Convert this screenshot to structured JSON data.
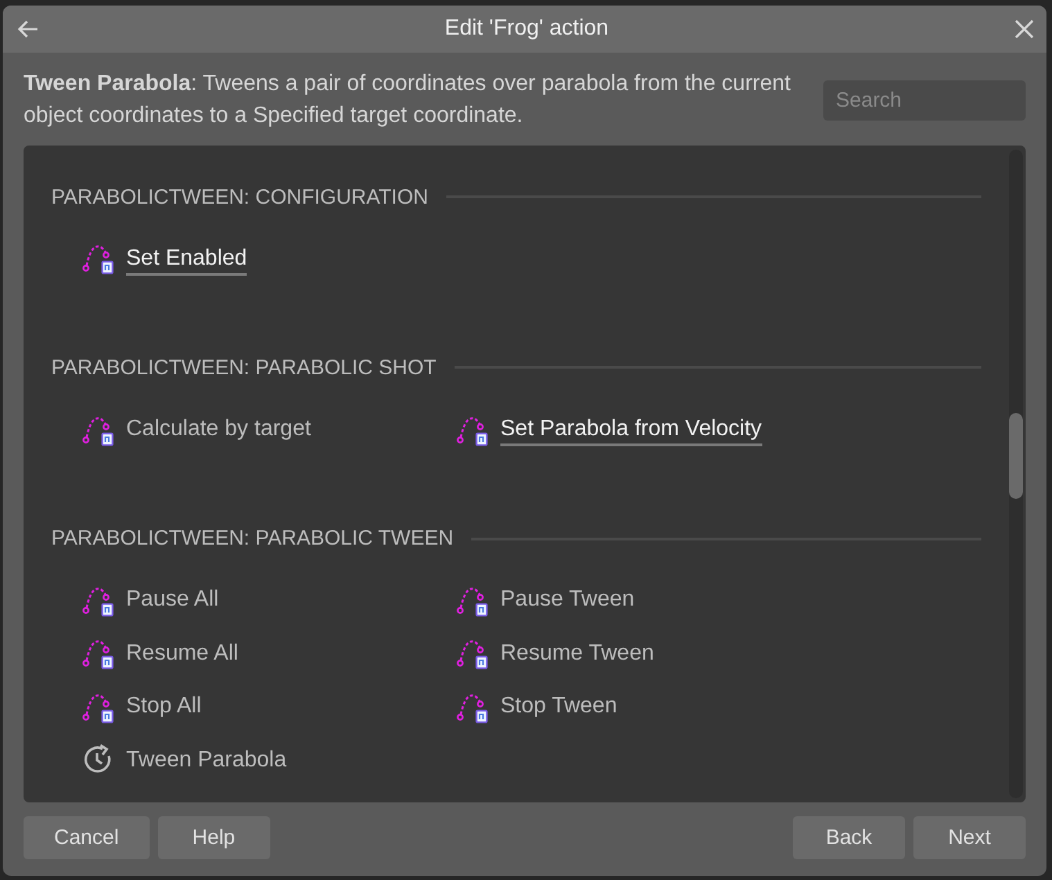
{
  "dialog": {
    "title": "Edit 'Frog' action"
  },
  "description": "**Tween Parabola**: Tweens a pair of coordinates over parabola from the current object coordinates to a Specified target coordinate.",
  "search": {
    "placeholder": "Search"
  },
  "sections": [
    {
      "heading": "PARABOLICTWEEN: CONFIGURATION",
      "items": [
        {
          "label": "Set Enabled",
          "kind": "parabola",
          "highlighted": true
        }
      ]
    },
    {
      "heading": "PARABOLICTWEEN: PARABOLIC SHOT",
      "items": [
        {
          "label": "Calculate by target",
          "kind": "parabola",
          "highlighted": false
        },
        {
          "label": "Set Parabola from Velocity",
          "kind": "parabola",
          "highlighted": true
        }
      ]
    },
    {
      "heading": "PARABOLICTWEEN: PARABOLIC TWEEN",
      "items": [
        {
          "label": "Pause All",
          "kind": "parabola",
          "highlighted": false
        },
        {
          "label": "Pause Tween",
          "kind": "parabola",
          "highlighted": false
        },
        {
          "label": "Resume All",
          "kind": "parabola",
          "highlighted": false
        },
        {
          "label": "Resume Tween",
          "kind": "parabola",
          "highlighted": false
        },
        {
          "label": "Stop All",
          "kind": "parabola",
          "highlighted": false
        },
        {
          "label": "Stop Tween",
          "kind": "parabola",
          "highlighted": false
        },
        {
          "label": "Tween Parabola",
          "kind": "clock",
          "highlighted": false
        }
      ]
    }
  ],
  "buttons": {
    "left": [
      "Cancel",
      "Help"
    ],
    "right": [
      "Back",
      "Next"
    ]
  }
}
